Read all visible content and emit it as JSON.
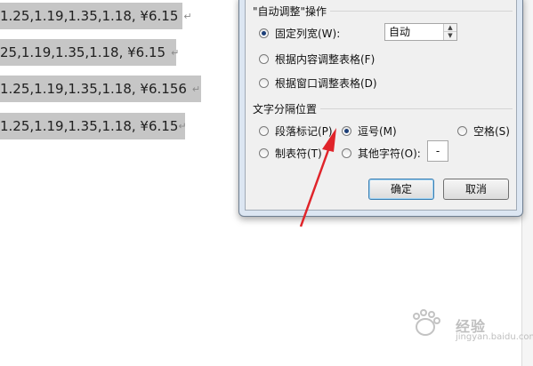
{
  "document": {
    "lines": [
      "1.25,1.19,1.35,1.18, ¥6.15",
      "25,1.19,1.35,1.18, ¥6.15",
      "1.25,1.19,1.35,1.18, ¥6.156",
      "1.25,1.19,1.35,1.18, ¥6.15"
    ],
    "paragraph_mark": "↵"
  },
  "dialog": {
    "autofit_group_title": "\"自动调整\"操作",
    "fixed_width_label": "固定列宽(W):",
    "fixed_width_value": "自动",
    "fit_content_label": "根据内容调整表格(F)",
    "fit_window_label": "根据窗口调整表格(D)",
    "separator_group_title": "文字分隔位置",
    "separators": {
      "paragraph": "段落标记(P)",
      "comma": "逗号(M)",
      "space": "空格(S)",
      "tab": "制表符(T)",
      "other": "其他字符(O):"
    },
    "other_char_value": "-",
    "ok_label": "确定",
    "cancel_label": "取消"
  },
  "watermark": {
    "text": "经验",
    "sub": "jingyan.baidu.com"
  },
  "colors": {
    "highlight": "#c6c6c6",
    "arrow": "#e0242a",
    "dialog_frame": "#dce6f2"
  }
}
